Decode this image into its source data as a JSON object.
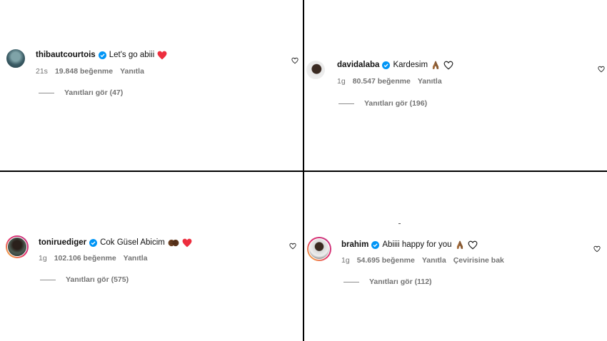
{
  "comments": [
    {
      "username": "thibautcourtois",
      "text": "Let's go abiii",
      "emoji": "red-heart",
      "time": "21s",
      "likes": "19.848 beğenme",
      "reply": "Yanıtla",
      "view_replies": "Yanıtları gör (47)"
    },
    {
      "username": "davidalaba",
      "text": "Kardesim",
      "emoji": "praying-hands-outline-heart",
      "time": "1g",
      "likes": "80.547 beğenme",
      "reply": "Yanıtla",
      "view_replies": "Yanıtları gör (196)"
    },
    {
      "username": "toniruediger",
      "text": "Cok Güsel Abicim",
      "emoji": "handshake-red-heart",
      "time": "1g",
      "likes": "102.106 beğenme",
      "reply": "Yanıtla",
      "view_replies": "Yanıtları gör (575)"
    },
    {
      "username": "brahim",
      "text": "Abiiii happy for you",
      "emoji": "praying-hands-outline-heart",
      "time": "1g",
      "likes": "54.695 beğenme",
      "reply": "Yanıtla",
      "translate": "Çevirisine bak",
      "view_replies": "Yanıtları gör (112)"
    }
  ],
  "colors": {
    "verified": "#0095f6",
    "heart": "#ed2e3e",
    "muted": "#737373"
  }
}
